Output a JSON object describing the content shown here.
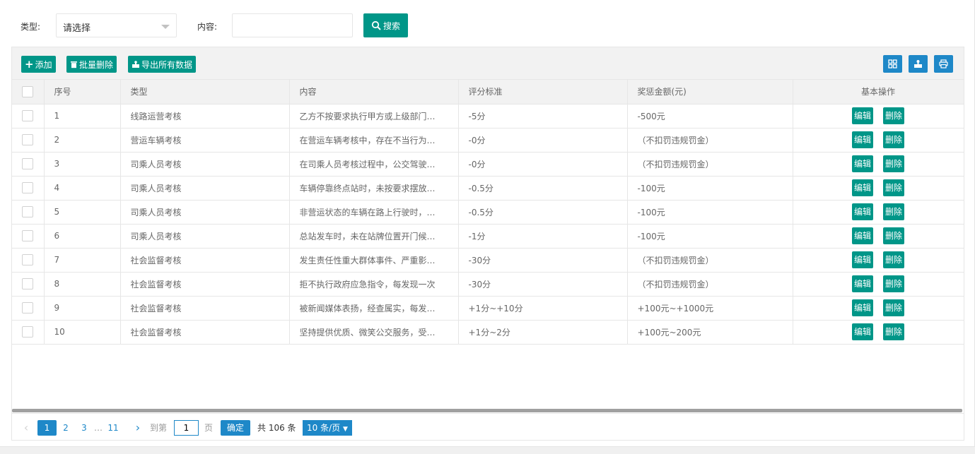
{
  "search": {
    "type_label": "类型:",
    "type_value": "请选择",
    "content_label": "内容:",
    "content_placeholder": "",
    "search_button": "搜索"
  },
  "toolbar": {
    "add": "添加",
    "batch_delete": "批量删除",
    "export": "导出所有数据",
    "icons": [
      "columns-icon",
      "export-icon",
      "print-icon"
    ]
  },
  "table": {
    "headers": [
      "序号",
      "类型",
      "内容",
      "评分标准",
      "奖惩金额(元)",
      "基本操作"
    ],
    "edit_label": "编辑",
    "delete_label": "删除",
    "rows": [
      {
        "no": "1",
        "type": "线路运营考核",
        "content": "乙方不按要求执行甲方或上级部门…",
        "score": "-5分",
        "amount": "-500元"
      },
      {
        "no": "2",
        "type": "营运车辆考核",
        "content": "在营运车辆考核中，存在不当行为…",
        "score": "-0分",
        "amount": "（不扣罚违规罚金）"
      },
      {
        "no": "3",
        "type": "司乘人员考核",
        "content": "在司乘人员考核过程中，公交驾驶…",
        "score": "-0分",
        "amount": "（不扣罚违规罚金）"
      },
      {
        "no": "4",
        "type": "司乘人员考核",
        "content": "车辆停靠终点站时，未按要求摆放…",
        "score": "-0.5分",
        "amount": "-100元"
      },
      {
        "no": "5",
        "type": "司乘人员考核",
        "content": "非营运状态的车辆在路上行驶时，…",
        "score": "-0.5分",
        "amount": "-100元"
      },
      {
        "no": "6",
        "type": "司乘人员考核",
        "content": "总站发车时，未在站牌位置开门候…",
        "score": "-1分",
        "amount": "-100元"
      },
      {
        "no": "7",
        "type": "社会监督考核",
        "content": "发生责任性重大群体事件、严重影…",
        "score": "-30分",
        "amount": "（不扣罚违规罚金）"
      },
      {
        "no": "8",
        "type": "社会监督考核",
        "content": "拒不执行政府应急指令，每发现一次",
        "score": "-30分",
        "amount": "（不扣罚违规罚金）"
      },
      {
        "no": "9",
        "type": "社会监督考核",
        "content": "被新闻媒体表扬，经查属实，每发…",
        "score": "+1分~+10分",
        "amount": "+100元~+1000元"
      },
      {
        "no": "10",
        "type": "社会监督考核",
        "content": "坚持提供优质、微笑公交服务，受…",
        "score": "+1分~2分",
        "amount": "+100元~200元"
      }
    ]
  },
  "pager": {
    "prev": "‹",
    "pages": [
      "1",
      "2",
      "3"
    ],
    "ellipsis": "…",
    "last": "11",
    "next": "›",
    "goto_label": "到第",
    "goto_value": "1",
    "page_unit": "页",
    "confirm": "确定",
    "total_text": "共 106 条",
    "page_size": "10 条/页"
  },
  "colors": {
    "primary": "#009688",
    "blue": "#1e88c8"
  }
}
